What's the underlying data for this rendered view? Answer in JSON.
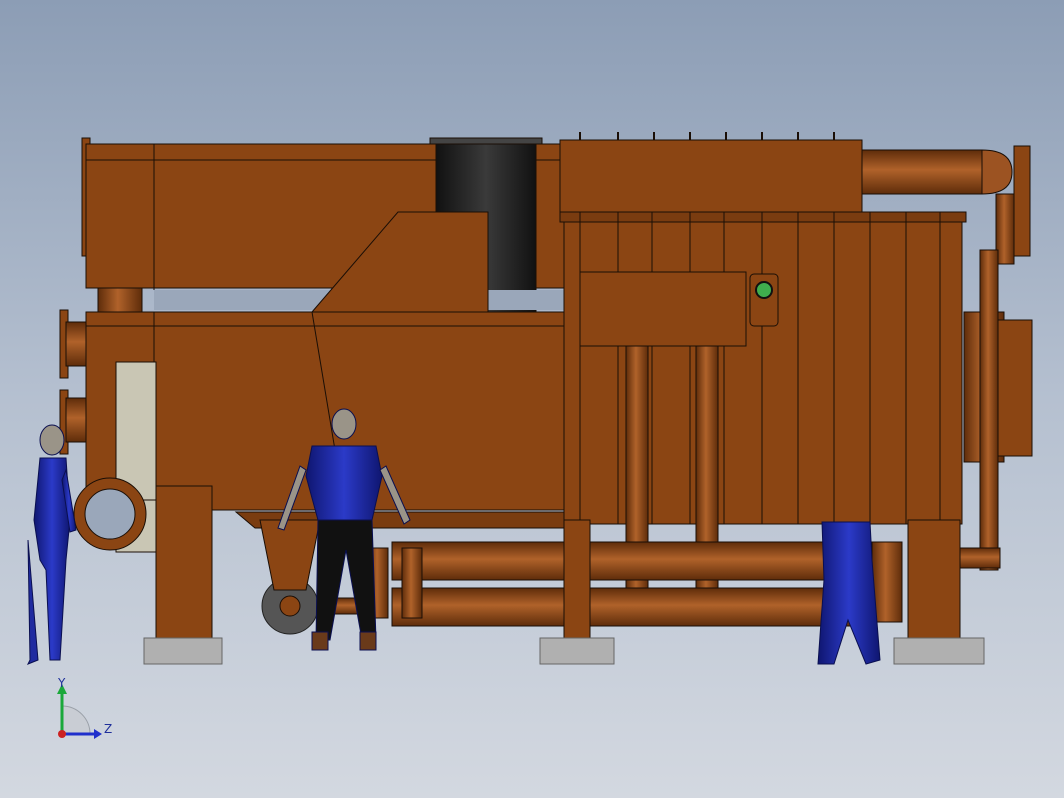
{
  "viewport": {
    "background_top": "#8c9db5",
    "background_bottom": "#d3d8e0"
  },
  "model": {
    "body_color": "#8b4513",
    "outline_color": "#1a0e06",
    "chimney_color": "#1e1e1e",
    "foot_color": "#b0b0b0",
    "figure_color": "#1f2aa0",
    "indicator_color": "#3fae4e"
  },
  "triad": {
    "y_label": "Y",
    "z_label": "Z",
    "y_color": "#1aa83a",
    "z_color": "#1f2fcc",
    "x_color": "#cc2222"
  }
}
